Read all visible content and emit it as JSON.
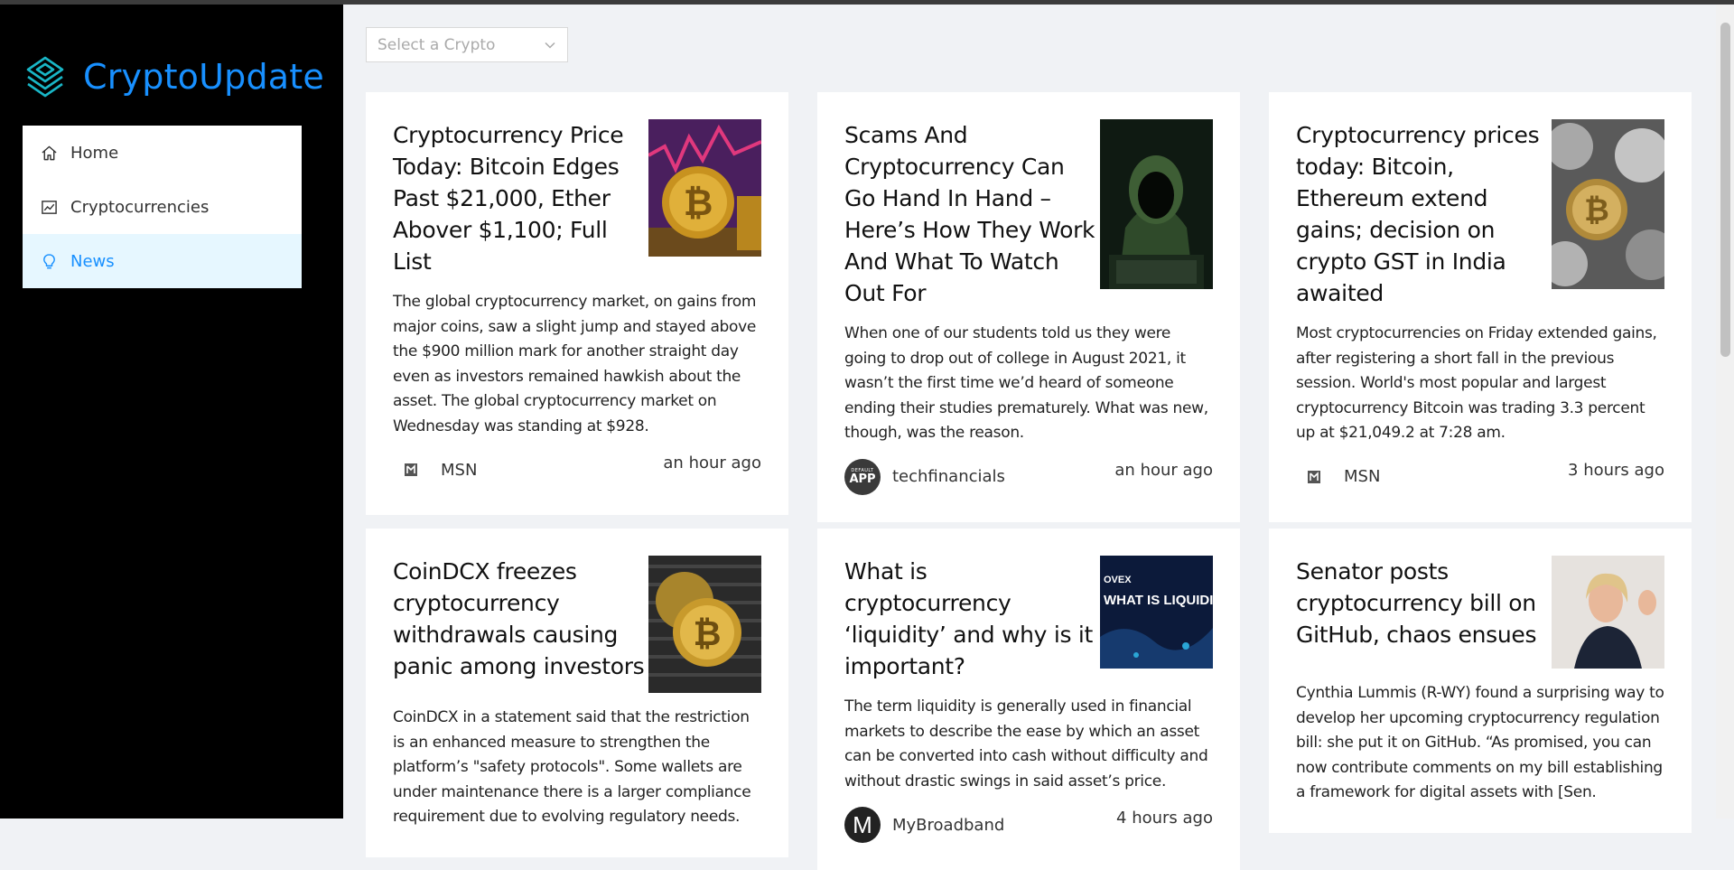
{
  "brand": {
    "title": "CryptoUpdate",
    "color": "#1890ff",
    "icon": "layered-diamond-icon"
  },
  "nav": {
    "items": [
      {
        "label": "Home",
        "icon": "home-icon"
      },
      {
        "label": "Cryptocurrencies",
        "icon": "line-chart-icon"
      },
      {
        "label": "News",
        "icon": "bulb-icon",
        "active": true
      }
    ]
  },
  "filter": {
    "placeholder": "Select a Crypto"
  },
  "news": [
    {
      "title": "Cryptocurrency Price Today: Bitcoin Edges Past $21,000, Ether Abover $1,100; Full List",
      "description": "The global cryptocurrency market, on gains from major coins, saw a slight jump and stayed above the $900 million mark for another straight day even as investors remained hawkish about the asset. The global cryptocurrency market on Wednesday was standing at $928.",
      "provider": "MSN",
      "time": "an hour ago"
    },
    {
      "title": "Scams And Cryptocurrency Can Go Hand In Hand – Here’s How They Work And What To Watch Out For",
      "description": "When one of our students told us they were going to drop out of college in August 2021, it wasn’t the first time we’d heard of someone ending their studies prematurely. What was new, though, was the reason.",
      "provider": "techfinancials",
      "provider_avatar_top": "DEFAULT",
      "provider_avatar_text": "APP",
      "time": "an hour ago"
    },
    {
      "title": "Cryptocurrency prices today: Bitcoin, Ethereum extend gains; decision on crypto GST in India awaited",
      "description": "Most cryptocurrencies on Friday extended gains, after registering a short fall in the previous session. World's most popular and largest cryptocurrency Bitcoin was trading 3.3 percent up at $21,049.2 at 7:28 am.",
      "provider": "MSN",
      "time": "3 hours ago"
    },
    {
      "title": "CoinDCX freezes cryptocurrency withdrawals causing panic among investors",
      "description": "CoinDCX in a statement said that the restriction is an enhanced measure to strengthen the platform’s \"safety protocols\". Some wallets are under maintenance there is a larger compliance requirement due to evolving regulatory needs."
    },
    {
      "title": "What is cryptocurrency ‘liquidity’ and why is it important?",
      "description": "The term liquidity is generally used in financial markets to describe the ease by which an asset can be converted into cash without difficulty and without drastic swings in said asset’s price.",
      "provider": "MyBroadband",
      "provider_avatar_text": "M",
      "time": "4 hours ago",
      "image_text_brand": "OVEX",
      "image_text_main": "WHAT IS LIQUIDIT"
    },
    {
      "title": "Senator posts cryptocurrency bill on GitHub, chaos ensues",
      "description": "Cynthia Lummis (R-WY) found a surprising way to develop her upcoming cryptocurrency regulation bill: she put it on GitHub. “As promised, you can now contribute comments on my bill establishing a framework for digital assets with [Sen."
    }
  ]
}
